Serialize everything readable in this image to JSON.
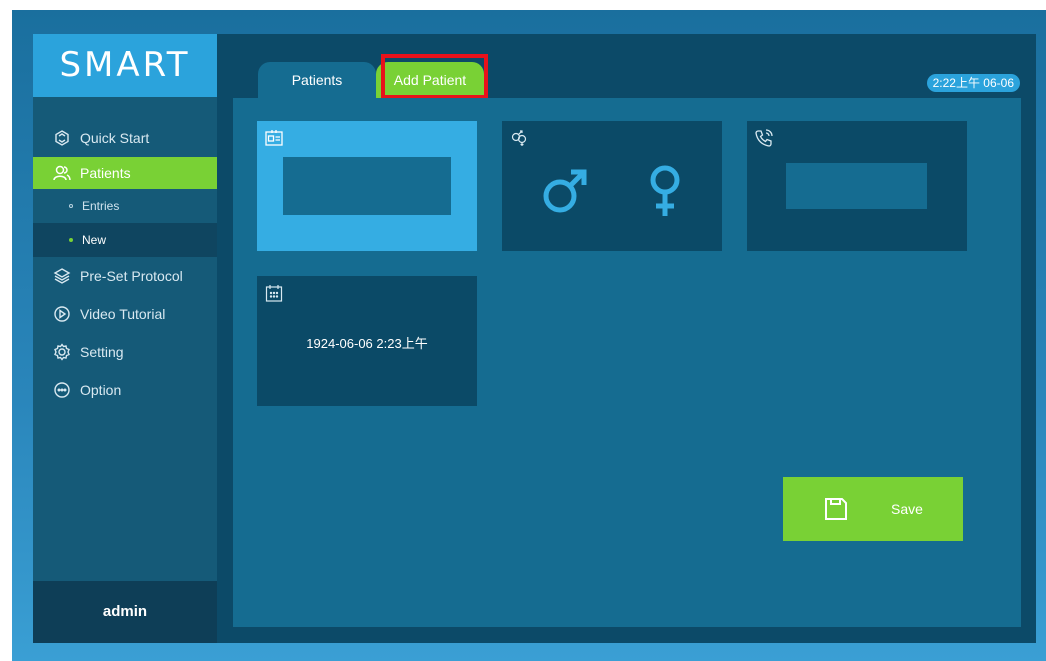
{
  "app": {
    "logo_text": "SMART"
  },
  "sidebar": {
    "items": [
      {
        "label": "Quick Start",
        "icon": "quick-start-icon"
      },
      {
        "label": "Patients",
        "icon": "patients-icon"
      },
      {
        "label": "Pre-Set Protocol",
        "icon": "layers-icon"
      },
      {
        "label": "Video Tutorial",
        "icon": "play-circle-icon"
      },
      {
        "label": "Setting",
        "icon": "gear-icon"
      },
      {
        "label": "Option",
        "icon": "more-circle-icon"
      }
    ],
    "sub_items": [
      {
        "label": "Entries"
      },
      {
        "label": "New"
      }
    ],
    "user": "admin"
  },
  "tabs": [
    {
      "label": "Patients"
    },
    {
      "label": "Add Patient"
    }
  ],
  "clock": "2:22上午 06-06",
  "form": {
    "id_field": {
      "icon": "id-card-icon",
      "value": ""
    },
    "gender": {
      "icon": "gender-icon",
      "male_symbol": "♂",
      "female_symbol": "♀"
    },
    "phone_field": {
      "icon": "phone-icon",
      "value": ""
    },
    "birth_field": {
      "icon": "calendar-icon",
      "value": "1924-06-06 2:23上午"
    }
  },
  "save_button": {
    "label": "Save",
    "icon": "save-icon"
  },
  "colors": {
    "accent_green": "#79d135",
    "accent_blue": "#35ade3",
    "panel_dark": "#0b4a67",
    "highlight_red": "#e8121b"
  }
}
